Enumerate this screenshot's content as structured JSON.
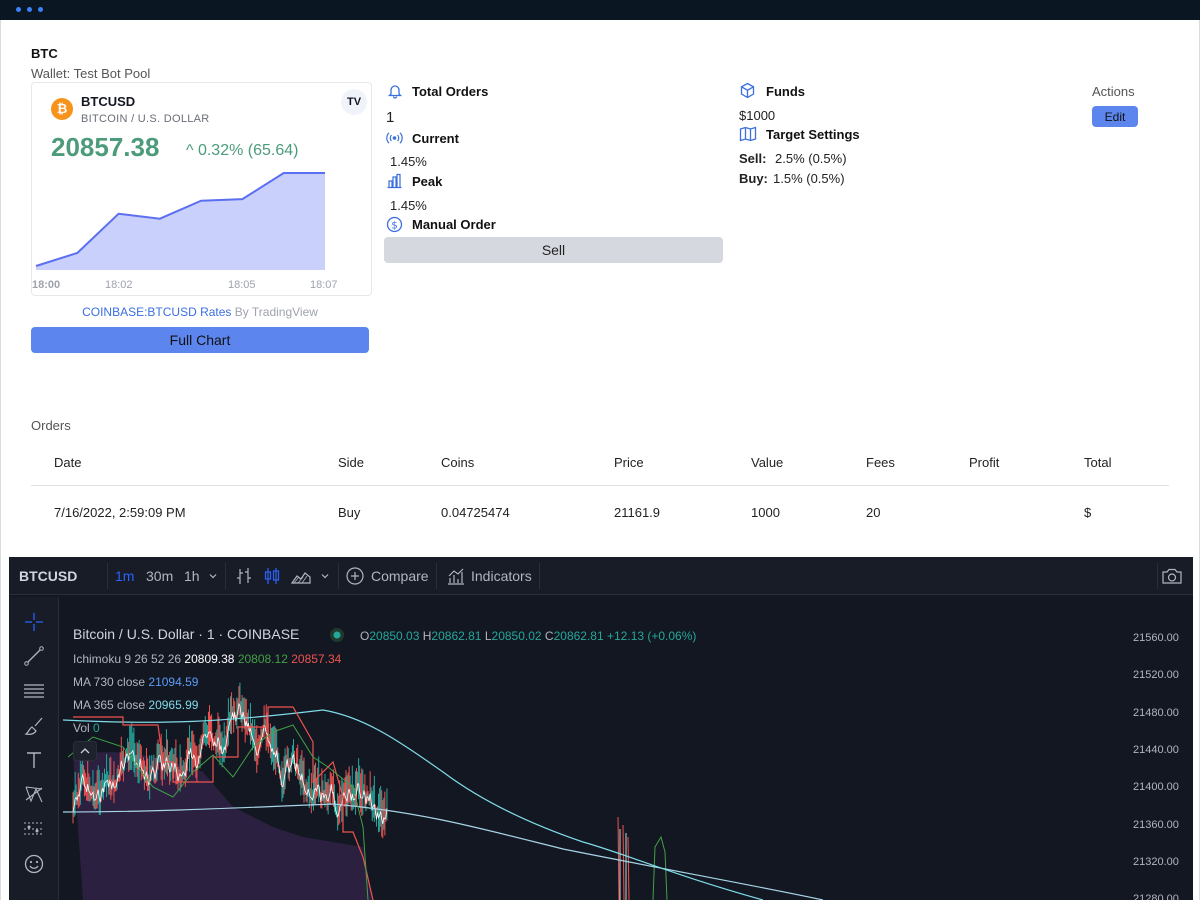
{
  "header": {
    "pair": "BTC",
    "wallet": "Wallet: Test Bot Pool"
  },
  "widget": {
    "symbol": "BTCUSD",
    "description": "BITCOIN / U.S. DOLLAR",
    "price": "20857.38",
    "change": "^ 0.32% (65.64)",
    "logo": "TV",
    "coin_glyph": "₿",
    "chart_data": {
      "type": "area",
      "x": [
        "18:00",
        "18:01",
        "18:02",
        "18:03",
        "18:04",
        "18:05",
        "18:06",
        "18:07"
      ],
      "values": [
        20800,
        20808,
        20832,
        20829,
        20840,
        20841,
        20857,
        20857
      ],
      "ticks": [
        "18:00",
        "18:02",
        "18:05",
        "18:07"
      ],
      "color": "#5c6ff0"
    },
    "attribution_link": "COINBASE:BTCUSD Rates",
    "attribution_by": " By TradingView",
    "full_chart_label": "Full Chart"
  },
  "stats": {
    "total_orders_label": "Total Orders",
    "total_orders_value": "1",
    "current_label": "Current",
    "current_value": "1.45%",
    "peak_label": "Peak",
    "peak_value": "1.45%",
    "manual_order_label": "Manual Order",
    "sell_label": "Sell",
    "funds_label": "Funds",
    "funds_value": "$1000",
    "target_label": "Target Settings",
    "sell_key": "Sell:",
    "sell_value": "2.5% (0.5%)",
    "buy_key": "Buy:",
    "buy_value": "1.5% (0.5%)",
    "actions_label": "Actions",
    "edit_label": "Edit"
  },
  "orders": {
    "title": "Orders",
    "columns": [
      "Date",
      "Side",
      "Coins",
      "Price",
      "Value",
      "Fees",
      "Profit",
      "Total"
    ],
    "rows": [
      [
        "7/16/2022, 2:59:09 PM",
        "Buy",
        "0.04725474",
        "21161.9",
        "1000",
        "20",
        "",
        "$"
      ]
    ]
  },
  "tv": {
    "symbol": "BTCUSD",
    "intervals": [
      "1m",
      "30m",
      "1h"
    ],
    "compare": "Compare",
    "indicators": "Indicators",
    "title": "Bitcoin / U.S. Dollar · 1 · COINBASE",
    "ohlc": {
      "o_key": "O",
      "o": "20850.03",
      "h_key": "H",
      "h": "20862.81",
      "l_key": "L",
      "l": "20850.02",
      "c_key": "C",
      "c": "20862.81",
      "chg": "+12.13 (+0.06%)"
    },
    "ichimoku": {
      "label": "Ichimoku 9 26 52 26",
      "v1": "20809.38",
      "v2": "20808.12",
      "v3": "20857.34"
    },
    "ma730": {
      "label": "MA 730 close",
      "value": "21094.59"
    },
    "ma365": {
      "label": "MA 365 close",
      "value": "20965.99"
    },
    "vol": {
      "label": "Vol",
      "value": "0"
    },
    "y_ticks": [
      "21560.00",
      "21520.00",
      "21480.00",
      "21440.00",
      "21400.00",
      "21360.00",
      "21320.00",
      "21280.00"
    ]
  }
}
